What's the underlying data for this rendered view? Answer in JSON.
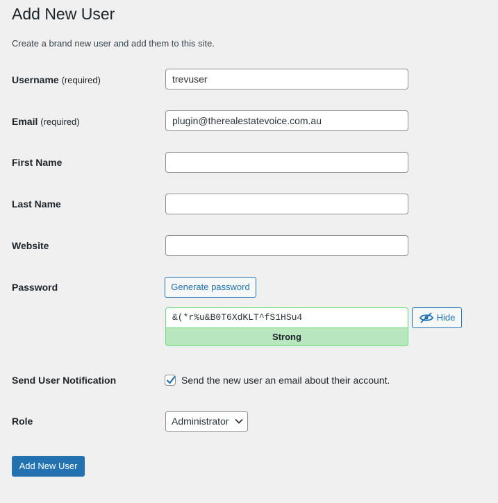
{
  "page": {
    "title": "Add New User",
    "description": "Create a brand new user and add them to this site."
  },
  "form": {
    "username": {
      "label": "Username",
      "required_note": "(required)",
      "value": "trevuser"
    },
    "email": {
      "label": "Email",
      "required_note": "(required)",
      "value": "plugin@therealestatevoice.com.au"
    },
    "first_name": {
      "label": "First Name",
      "value": ""
    },
    "last_name": {
      "label": "Last Name",
      "value": ""
    },
    "website": {
      "label": "Website",
      "value": ""
    },
    "password": {
      "label": "Password",
      "generate_button": "Generate password",
      "value": "&(*r%u&B0T6XdKLT^fS1HSu4",
      "strength": "Strong",
      "toggle_button": "Hide",
      "toggle_icon": "eye-slash-icon"
    },
    "notification": {
      "label": "Send User Notification",
      "checkbox_label": "Send the new user an email about their account.",
      "checked": true
    },
    "role": {
      "label": "Role",
      "selected": "Administrator"
    },
    "submit_label": "Add New User"
  },
  "colors": {
    "primary": "#2271b1",
    "background": "#f0f0f1",
    "strength_bg": "#b8e6bf",
    "strength_border": "#68de7c"
  }
}
